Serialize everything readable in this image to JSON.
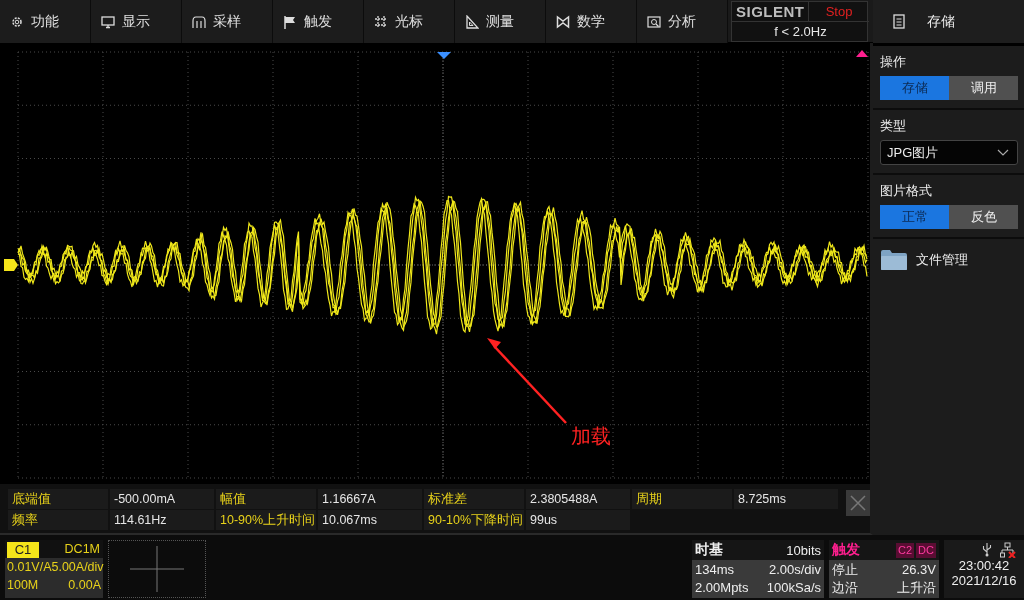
{
  "menu": [
    {
      "label": "功能"
    },
    {
      "label": "显示"
    },
    {
      "label": "采样"
    },
    {
      "label": "触发"
    },
    {
      "label": "光标"
    },
    {
      "label": "测量"
    },
    {
      "label": "数学"
    },
    {
      "label": "分析"
    }
  ],
  "brand": {
    "logo": "SIGLENT",
    "run_state": "Stop",
    "frequency": "f < 2.0Hz"
  },
  "panel": {
    "title": "存储",
    "sections": [
      {
        "kind": "toggle",
        "label": "操作",
        "options": [
          {
            "label": "存储",
            "selected": true
          },
          {
            "label": "调用",
            "selected": false
          }
        ]
      },
      {
        "kind": "dropdown",
        "label": "类型",
        "value": "JPG图片"
      },
      {
        "kind": "toggle",
        "label": "图片格式",
        "options": [
          {
            "label": "正常",
            "selected": true
          },
          {
            "label": "反色",
            "selected": false
          }
        ]
      },
      {
        "kind": "folder",
        "label": "文件管理"
      }
    ]
  },
  "screen": {
    "annotation": "加载"
  },
  "measurements": [
    {
      "label": "底端值",
      "value": "-500.00mA"
    },
    {
      "label": "幅值",
      "value": "1.16667A"
    },
    {
      "label": "标准差",
      "value": "2.3805488A"
    },
    {
      "label": "周期",
      "value": "8.725ms"
    },
    {
      "label": "频率",
      "value": "114.61Hz"
    },
    {
      "label": "10-90%上升时间",
      "value": "10.067ms"
    },
    {
      "label": "90-10%下降时间",
      "value": "99us"
    }
  ],
  "channel": {
    "name": "C1",
    "coupling": "DC1M",
    "probe": "0.01V/A",
    "scale": "5.00A/div",
    "bandwidth": "100M",
    "offset": "0.00A"
  },
  "timebase": {
    "title": "时基",
    "bits": "10bits",
    "delay": "134ms",
    "scale": "2.00s/div",
    "memory": "2.00Mpts",
    "sample_rate": "100kSa/s"
  },
  "trigger": {
    "title": "触发",
    "source": "C2",
    "coupling": "DC",
    "state": "停止",
    "trigger_level": "26.3V",
    "type": "边沿",
    "slope": "上升沿"
  },
  "clock": {
    "time": "23:00:42",
    "date": "2021/12/16"
  }
}
